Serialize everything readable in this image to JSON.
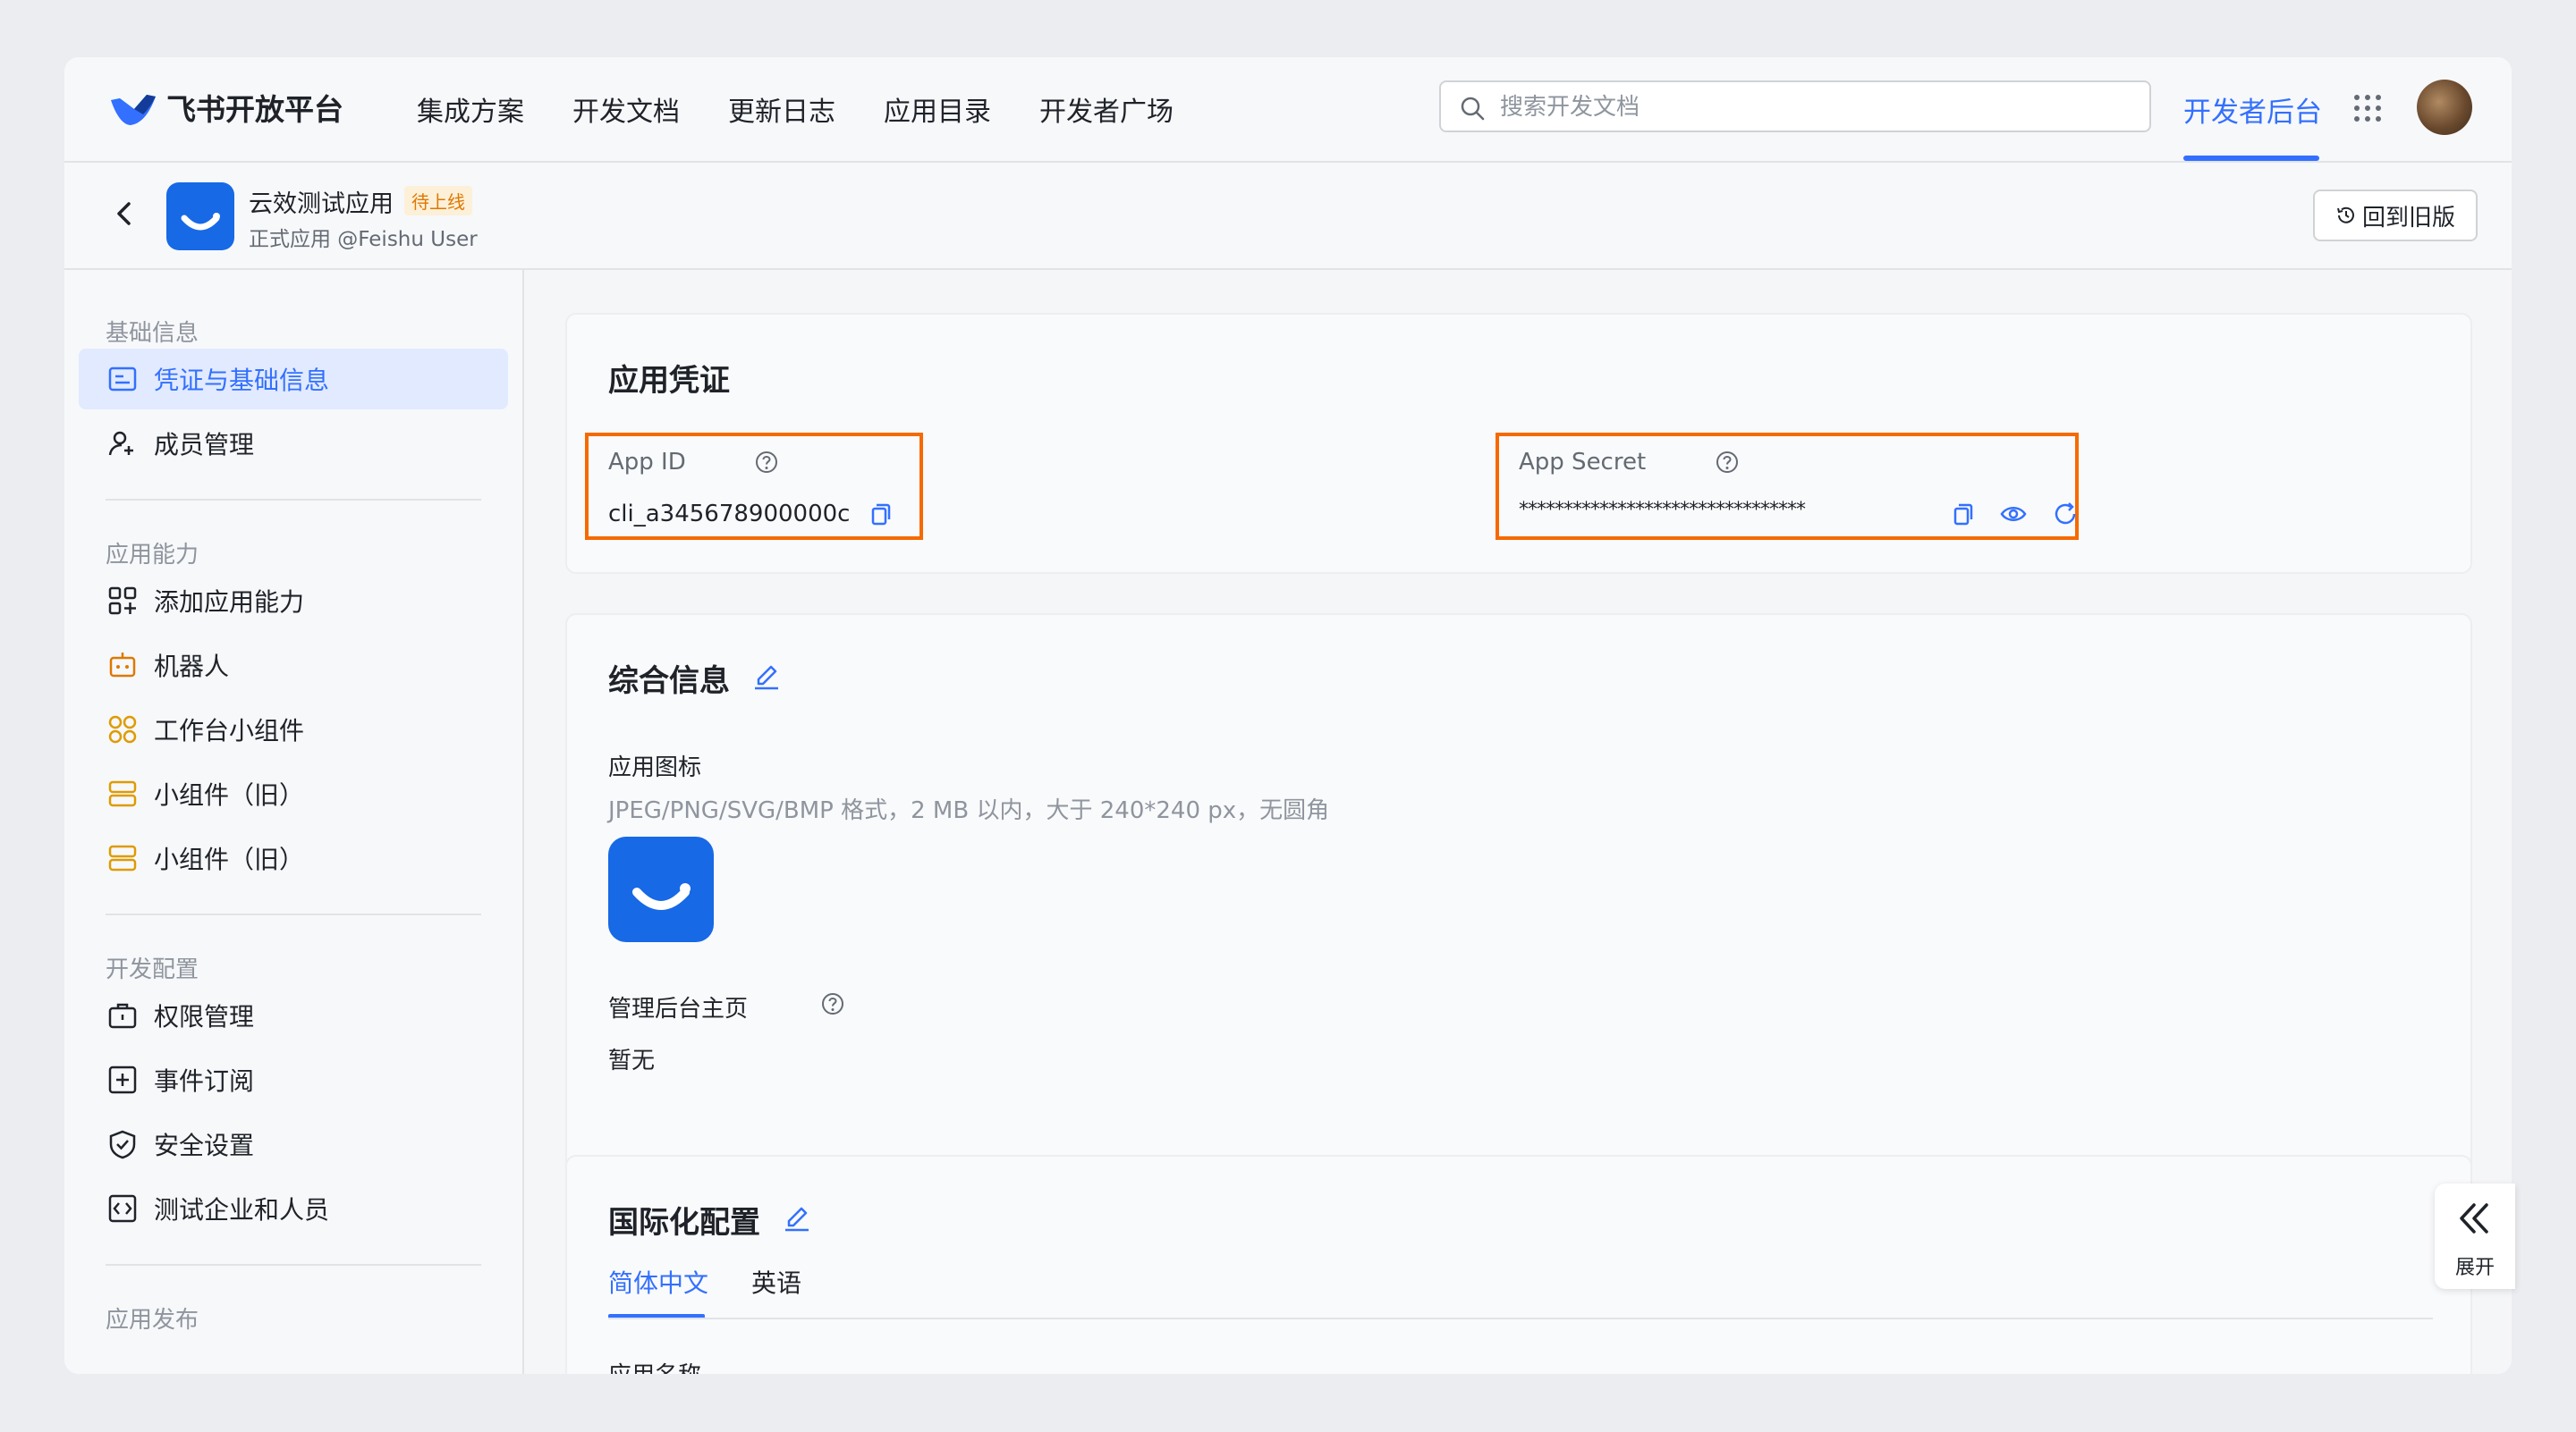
{
  "brand": {
    "name": "飞书开放平台"
  },
  "nav": {
    "links": [
      "集成方案",
      "开发文档",
      "更新日志",
      "应用目录",
      "开发者广场"
    ],
    "search_placeholder": "搜索开发文档",
    "active_tab": "开发者后台"
  },
  "app": {
    "name": "云效测试应用",
    "status_badge": "待上线",
    "subtitle": "正式应用 @Feishu User",
    "old_version_button": "回到旧版"
  },
  "sidebar": {
    "sections": [
      {
        "title": "基础信息",
        "items": [
          "凭证与基础信息",
          "成员管理"
        ]
      },
      {
        "title": "应用能力",
        "items": [
          "添加应用能力",
          "机器人",
          "工作台小组件",
          "小组件（旧）",
          "小组件（旧）"
        ]
      },
      {
        "title": "开发配置",
        "items": [
          "权限管理",
          "事件订阅",
          "安全设置",
          "测试企业和人员"
        ]
      },
      {
        "title": "应用发布",
        "items": []
      }
    ],
    "active_item": "凭证与基础信息"
  },
  "credentials": {
    "title": "应用凭证",
    "app_id_label": "App ID",
    "app_id_value": "cli_a345678900000c",
    "app_secret_label": "App Secret",
    "app_secret_value": "********************************"
  },
  "general": {
    "title": "综合信息",
    "icon_label": "应用图标",
    "icon_hint": "JPEG/PNG/SVG/BMP 格式，2 MB 以内，大于 240*240 px，无圆角",
    "admin_home_label": "管理后台主页",
    "admin_home_value": "暂无"
  },
  "i18n": {
    "title": "国际化配置",
    "tabs": [
      "简体中文",
      "英语"
    ],
    "field_label": "应用名称"
  },
  "expand": {
    "label": "展开"
  },
  "colors": {
    "accent": "#3370ff",
    "highlight": "#f56a00",
    "app_icon_bg": "#1769e6"
  }
}
